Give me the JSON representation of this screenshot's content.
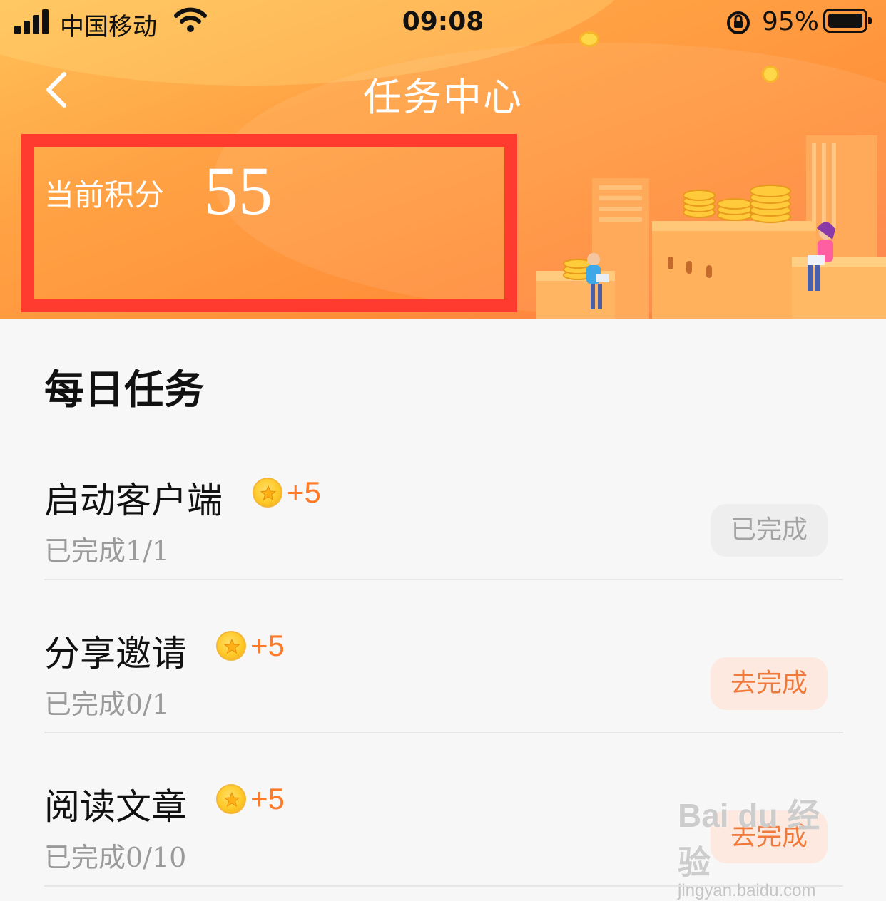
{
  "status_bar": {
    "carrier": "中国移动",
    "time": "09:08",
    "battery_percent": "95%"
  },
  "header": {
    "title": "任务中心",
    "points_label": "当前积分",
    "points_value": "55"
  },
  "daily": {
    "section_title": "每日任务",
    "tasks": [
      {
        "name": "启动客户端",
        "reward": "+5",
        "progress": "已完成1/1",
        "button": "已完成",
        "state": "done"
      },
      {
        "name": "分享邀请",
        "reward": "+5",
        "progress": "已完成0/1",
        "button": "去完成",
        "state": "go"
      },
      {
        "name": "阅读文章",
        "reward": "+5",
        "progress": "已完成0/10",
        "button": "去完成",
        "state": "go"
      }
    ]
  },
  "watermark": {
    "logo": "Bai du 经验",
    "url": "jingyan.baidu.com"
  },
  "colors": {
    "header_start": "#ffc158",
    "header_end": "#ff7a45",
    "highlight_border": "#ff3a2e",
    "reward_accent": "#ff7a28",
    "go_button_bg": "#fde9df",
    "done_button_bg": "#eeeeee"
  },
  "icons": [
    "signal-icon",
    "wifi-icon",
    "orientation-lock-icon",
    "battery-icon",
    "back-chevron-icon",
    "coin-icon"
  ]
}
